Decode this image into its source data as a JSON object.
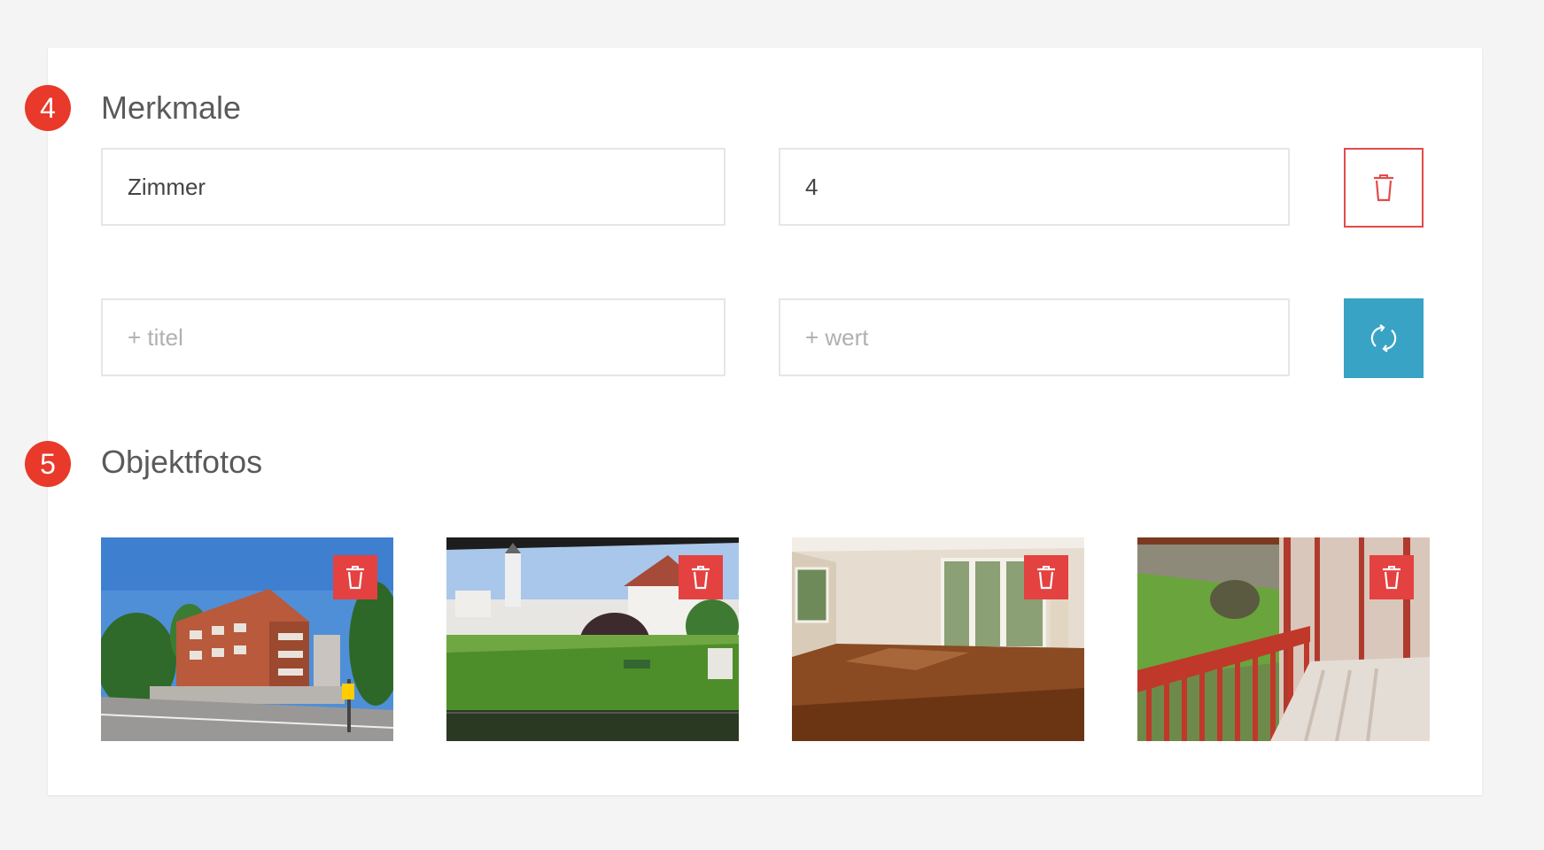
{
  "sections": [
    {
      "number": "4",
      "title": "Merkmale"
    },
    {
      "number": "5",
      "title": "Objektfotos"
    }
  ],
  "features": {
    "rows": [
      {
        "title_value": "Zimmer",
        "value_value": "4",
        "action_icon": "trash-icon"
      }
    ],
    "new_row": {
      "title_placeholder": "+ titel",
      "value_placeholder": "+ wert",
      "action_icon": "sync-icon"
    }
  },
  "photos": [
    {
      "subject": "apartment-building-exterior",
      "delete_icon": "trash-icon"
    },
    {
      "subject": "garden-view-with-church",
      "delete_icon": "trash-icon"
    },
    {
      "subject": "empty-living-room",
      "delete_icon": "trash-icon"
    },
    {
      "subject": "balcony-with-red-railing",
      "delete_icon": "trash-icon"
    }
  ],
  "colors": {
    "accent_red": "#e8392a",
    "delete_red": "#e44141",
    "sync_blue": "#38a3c4",
    "background": "#f4f4f4"
  }
}
